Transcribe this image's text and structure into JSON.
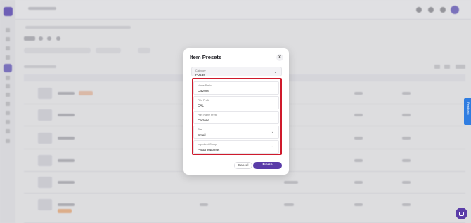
{
  "modal": {
    "title": "Item Presets",
    "close_glyph": "✕",
    "category": {
      "label": "Category",
      "value": "Pizzas"
    },
    "fields": {
      "name_prefix": {
        "label": "Name Prefix",
        "value": "Calzone"
      },
      "plu_prefix": {
        "label": "PLU Prefix",
        "value": "CAL"
      },
      "print_name_prefix": {
        "label": "Print Name Prefix",
        "value": "Calzone"
      },
      "size": {
        "label": "Size",
        "value": "Small"
      },
      "ingredient_group": {
        "label": "Ingredient Group",
        "value": "Pasta Toppings"
      }
    },
    "cancel_label": "Cancel",
    "finish_label": "Finish",
    "highlight_color": "#cf1a2c"
  },
  "sidebar_feedback": {
    "label": "Feedback"
  },
  "colors": {
    "accent": "#5a3ca8",
    "feedback": "#2f7de1"
  },
  "icons": {
    "close": "close-icon",
    "dropdown": "chevron-down-icon",
    "chat": "chat-icon",
    "logo": "app-logo-icon"
  }
}
